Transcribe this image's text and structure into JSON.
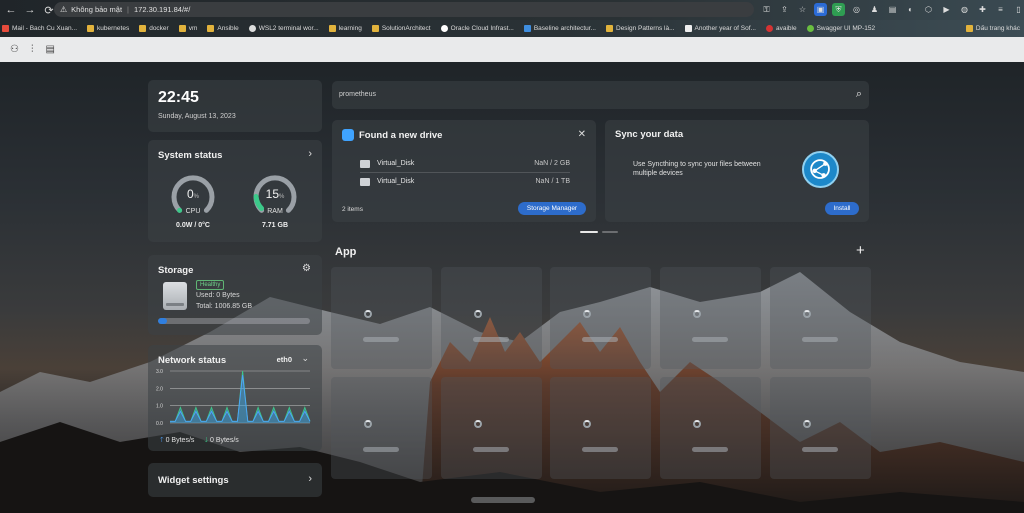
{
  "browser": {
    "url_warning": "Không bảo mật",
    "url": "172.30.191.84/#/",
    "bookmarks": [
      "Mail - Bach Cu Xuan...",
      "kubernetes",
      "docker",
      "vm",
      "Ansible",
      "WSL2 terminal wor...",
      "learning",
      "SolutionArchitect",
      "Oracle Cloud Infrast...",
      "Baseline architectur...",
      "Design Patterns là...",
      "Another year of Sof...",
      "avaible",
      "Swagger UI MP-152"
    ],
    "other_bookmarks": "Dấu trang khác"
  },
  "clock": {
    "time": "22:45",
    "date": "Sunday, August 13, 2023"
  },
  "system_status": {
    "title": "System status",
    "cpu": {
      "value": "0",
      "unit": "%",
      "label": "CPU",
      "sub": "0.0W / 0°C",
      "fraction": 0.0
    },
    "ram": {
      "value": "15",
      "unit": "%",
      "label": "RAM",
      "sub": "7.71 GB",
      "fraction": 0.15
    }
  },
  "storage": {
    "title": "Storage",
    "badge": "Healthy",
    "used": "Used: 0 Bytes",
    "total": "Total: 1006.85 GB",
    "fraction": 0.06
  },
  "network": {
    "title": "Network status",
    "interface": "eth0",
    "y_ticks": [
      "3.0",
      "2.0",
      "1.0",
      "0.0"
    ],
    "series": [
      0.1,
      0.1,
      0.9,
      0.1,
      0.1,
      0.9,
      0.1,
      0.1,
      0.9,
      0.1,
      0.1,
      0.9,
      0.1,
      0.1,
      3.0,
      0.1,
      0.1,
      0.9,
      0.1,
      0.1,
      0.9,
      0.1,
      0.1,
      0.9,
      0.1,
      0.1,
      0.9,
      0.1
    ],
    "upload": "0 Bytes/s",
    "download": "0 Bytes/s"
  },
  "widget_settings": {
    "title": "Widget settings"
  },
  "search": {
    "text": "prometheus"
  },
  "new_drive": {
    "title": "Found a new drive",
    "drives": [
      {
        "name": "Virtual_Disk",
        "size": "NaN / 2 GB"
      },
      {
        "name": "Virtual_Disk",
        "size": "NaN / 1 TB"
      }
    ],
    "count": "2 items",
    "button": "Storage Manager"
  },
  "sync": {
    "title": "Sync your data",
    "desc": "Use Syncthing to sync your files between multiple devices",
    "button": "Install"
  },
  "apps": {
    "title": "App",
    "tile_count": 10
  },
  "colors": {
    "accent": "#2d6ccb",
    "ok": "#3cc98a",
    "cpu_gauge": "#3cc98a",
    "ram_gauge": "#3cc98a"
  }
}
